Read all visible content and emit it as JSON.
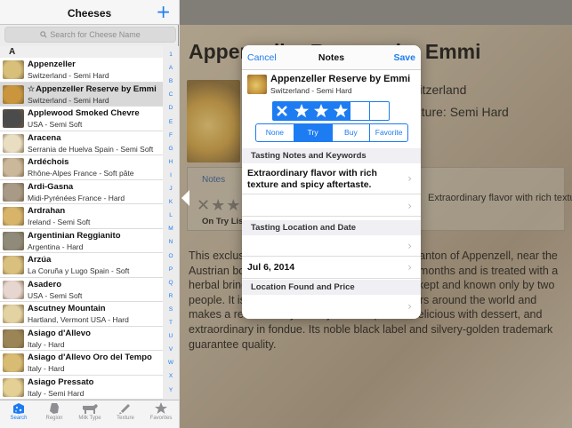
{
  "master": {
    "title": "Cheeses",
    "add_label": "+",
    "search_placeholder": "Search for Cheese Name",
    "section_letter": "A",
    "items": [
      {
        "name": "Appenzeller",
        "sub": "Switzerland - Semi Hard",
        "fav": "",
        "thumb": "#d8c07a"
      },
      {
        "name": "Appenzeller Reserve by Emmi",
        "sub": "Switzerland - Semi Hard",
        "fav": "☆",
        "thumb": "#c9963e"
      },
      {
        "name": "Applewood Smoked Chevre",
        "sub": "USA - Semi Soft",
        "fav": "",
        "thumb": "#4b4b4b"
      },
      {
        "name": "Aracena",
        "sub": "Serrania de Huelva  Spain - Semi Soft",
        "fav": "",
        "thumb": "#e9ddc2"
      },
      {
        "name": "Ardéchois",
        "sub": "Rhône-Alpes France - Soft pâte",
        "fav": "",
        "thumb": "#cbb89a"
      },
      {
        "name": "Ardi-Gasna",
        "sub": "Midi-Pyrénées France - Hard",
        "fav": "",
        "thumb": "#a89a86"
      },
      {
        "name": "Ardrahan",
        "sub": "Ireland - Semi Soft",
        "fav": "",
        "thumb": "#d7b46a"
      },
      {
        "name": "Argentinian Reggianito",
        "sub": "Argentina - Hard",
        "fav": "",
        "thumb": "#8f8a7a"
      },
      {
        "name": "Arzúa",
        "sub": "La Coruña y Lugo Spain - Soft",
        "fav": "",
        "thumb": "#d9c07e"
      },
      {
        "name": "Asadero",
        "sub": "USA - Semi Soft",
        "fav": "",
        "thumb": "#e7d6cf"
      },
      {
        "name": "Ascutney Mountain",
        "sub": "Hartland, Vermont USA - Hard",
        "fav": "",
        "thumb": "#e3d3a2"
      },
      {
        "name": "Asiago d'Allevo",
        "sub": "Italy - Hard",
        "fav": "",
        "thumb": "#9b8557"
      },
      {
        "name": "Asiago d'Allevo Oro del Tempo",
        "sub": "Italy - Hard",
        "fav": "",
        "thumb": "#d9bc74"
      },
      {
        "name": "Asiago Pressato",
        "sub": "Italy - Semi Hard",
        "fav": "",
        "thumb": "#e4cf94"
      }
    ],
    "index_letters": [
      "1",
      "A",
      "B",
      "C",
      "D",
      "E",
      "F",
      "G",
      "H",
      "I",
      "J",
      "K",
      "L",
      "M",
      "N",
      "O",
      "P",
      "Q",
      "R",
      "S",
      "T",
      "U",
      "V",
      "W",
      "X",
      "Y",
      "Z"
    ]
  },
  "tabbar": {
    "tabs": [
      {
        "label": "Search",
        "icon": "search-tab-icon",
        "active": true
      },
      {
        "label": "Region",
        "icon": "region-map-icon",
        "active": false
      },
      {
        "label": "Milk Type",
        "icon": "cow-icon",
        "active": false
      },
      {
        "label": "Texture",
        "icon": "texture-icon",
        "active": false
      },
      {
        "label": "Favorites",
        "icon": "star-icon",
        "active": false
      }
    ]
  },
  "detail": {
    "title": "Appenzeller Reserve by Emmi",
    "location": "Switzerland",
    "texture": "Texture: Semi Hard",
    "notes_tab": "Notes",
    "on_try_list": "On Try List",
    "notes_text": "Extraordinary flavor with rich texture and spicy aftertaste.",
    "description": "This exclusive Appenzeller is produced in the canton of Appenzell, near the Austrian border. The cheese is matured for six months and is treated with a herbal brine. The herbal recipe's secret is well-kept and known only by two people. It is appreciated by cheese connoisseurs around the world and makes a real delicacy on any cheese platter- delicious with dessert, and extraordinary in fondue. Its noble black label and silvery-golden trademark guarantee quality."
  },
  "popover": {
    "cancel": "Cancel",
    "title": "Notes",
    "save": "Save",
    "cheese_name": "Appenzeller Reserve by Emmi",
    "cheese_sub": "Switzerland - Semi Hard",
    "rating": 3,
    "rating_max": 5,
    "segments": [
      {
        "label": "None",
        "on": false
      },
      {
        "label": "Try",
        "on": true
      },
      {
        "label": "Buy",
        "on": false
      },
      {
        "label": "Favorite",
        "on": false
      }
    ],
    "section_tasting": "Tasting Notes and Keywords",
    "tasting_notes": "Extraordinary flavor with rich texture and spicy aftertaste.",
    "keywords": "",
    "section_location_date": "Tasting Location and Date",
    "tasting_location": "",
    "tasting_date": "Jul 6, 2014",
    "section_found_price": "Location Found and Price",
    "found_price": ""
  },
  "colors": {
    "accent": "#1d7cf2"
  }
}
